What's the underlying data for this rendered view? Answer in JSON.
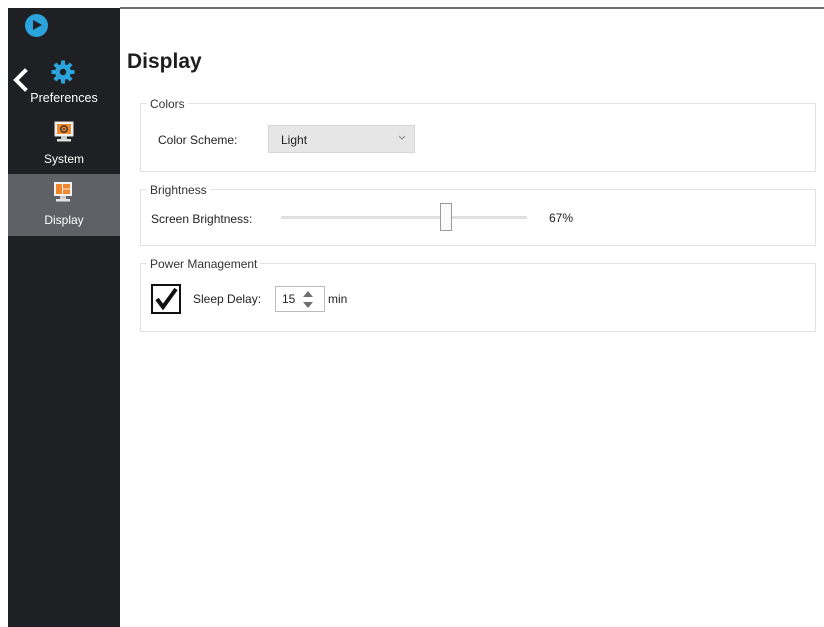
{
  "sidebar": {
    "items": [
      {
        "label": "Preferences",
        "icon": "gear-icon"
      },
      {
        "label": "System",
        "icon": "monitor-icon"
      },
      {
        "label": "Display",
        "icon": "display-layout-icon",
        "active": true
      }
    ]
  },
  "page": {
    "title": "Display"
  },
  "colors": {
    "legend": "Colors",
    "scheme_label": "Color Scheme:",
    "scheme_value": "Light"
  },
  "brightness": {
    "legend": "Brightness",
    "label": "Screen Brightness:",
    "value_text": "67%",
    "value": 0.67
  },
  "power": {
    "legend": "Power Management",
    "sleep_enabled": true,
    "sleep_label": "Sleep Delay:",
    "sleep_value": "15",
    "sleep_unit": "min"
  },
  "theme": {
    "accent": "#2ba3dc",
    "sidebar_bg": "#1f2023",
    "active_item_bg": "#5f6166",
    "icon_orange": "#f0862a"
  }
}
